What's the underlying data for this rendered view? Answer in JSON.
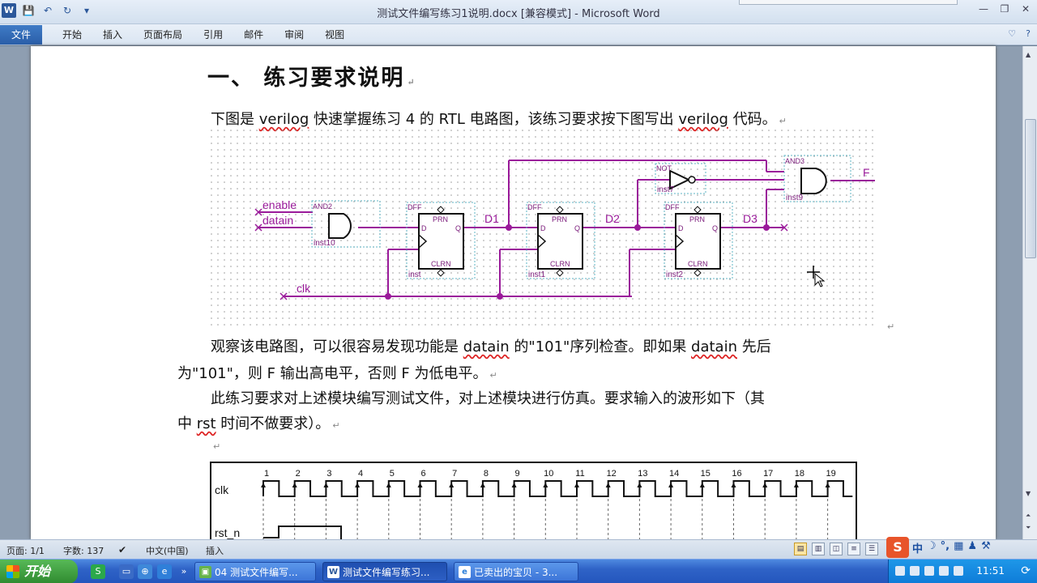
{
  "app": {
    "title": "测试文件编写练习1说明.docx [兼容模式] - Microsoft Word",
    "quick_access": [
      "W",
      "💾",
      "↶",
      "↻",
      "▾"
    ],
    "window_controls": [
      "—",
      "❐",
      "✕"
    ]
  },
  "ribbon": {
    "file_tab": "文件",
    "tabs": [
      "开始",
      "插入",
      "页面布局",
      "引用",
      "邮件",
      "审阅",
      "视图"
    ],
    "right_icons": [
      "♡",
      "?"
    ]
  },
  "document": {
    "heading": "一、 练习要求说明",
    "para1_pre": "下图是 ",
    "para1_w1": "verilog",
    "para1_mid": " 快速掌握练习 4 的 RTL 电路图，该练习要求按下图写出 ",
    "para1_w2": "verilog",
    "para1_post": " 代码。",
    "para2_l1_pre": "观察该电路图，可以很容易发现功能是 ",
    "para2_l1_w1": "datain",
    "para2_l1_mid": " 的\"101\"序列检查。即如果 ",
    "para2_l1_w2": "datain",
    "para2_l1_post": " 先后",
    "para2_l2": "为\"101\"，则 F 输出高电平，否则 F 为低电平。",
    "para3_l1": "此练习要求对上述模块编写测试文件，对上述模块进行仿真。要求输入的波形如下（其",
    "para3_l2_pre": "中 ",
    "para3_l2_w": "rst",
    "para3_l2_post": " 时间不做要求）。",
    "pilcrow": "↵"
  },
  "circuit": {
    "inputs": [
      "enable",
      "datain",
      "clk"
    ],
    "gate_and2": {
      "type": "AND2",
      "inst": "inst10"
    },
    "dff1": {
      "type": "DFF",
      "inst": "inst",
      "prn": "PRN",
      "clrn": "CLRN",
      "d": "D",
      "q": "Q"
    },
    "dff2": {
      "type": "DFF",
      "inst": "inst1",
      "prn": "PRN",
      "clrn": "CLRN",
      "d": "D",
      "q": "Q"
    },
    "dff3": {
      "type": "DFF",
      "inst": "inst2",
      "prn": "PRN",
      "clrn": "CLRN",
      "d": "D",
      "q": "Q"
    },
    "gate_not": {
      "type": "NOT",
      "inst": "inst7"
    },
    "gate_and3": {
      "type": "AND3",
      "inst": "inst9"
    },
    "nets": [
      "D1",
      "D2",
      "D3"
    ],
    "output": "F"
  },
  "timing": {
    "clock_numbers": [
      "1",
      "2",
      "3",
      "4",
      "5",
      "6",
      "7",
      "8",
      "9",
      "10",
      "11",
      "12",
      "13",
      "14",
      "15",
      "16",
      "17",
      "18",
      "19"
    ],
    "signals": [
      "clk",
      "rst_n"
    ]
  },
  "statusbar": {
    "page": "页面: 1/1",
    "words": "字数: 137",
    "language": "中文(中国)",
    "mode": "插入"
  },
  "ime": {
    "logo": "S",
    "items": [
      "中",
      "☽",
      "°,",
      "▦",
      "♟",
      "⚒"
    ]
  },
  "taskbar": {
    "start": "开始",
    "tasks": [
      {
        "label": "04 测试文件编写...",
        "icon": "▣"
      },
      {
        "label": "测试文件编写练习...",
        "icon": "W"
      },
      {
        "label": "已卖出的宝贝 - 3...",
        "icon": "e"
      }
    ],
    "clock": "11:51"
  }
}
